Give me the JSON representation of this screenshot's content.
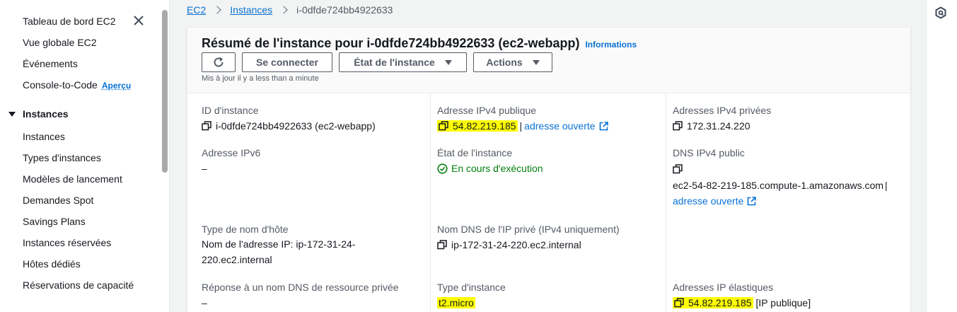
{
  "sidebar": {
    "items_top": [
      "Tableau de bord EC2",
      "Vue globale EC2",
      "Événements",
      "Console-to-Code"
    ],
    "console_badge": "Aperçu",
    "section": "Instances",
    "instances_items": [
      "Instances",
      "Types d'instances",
      "Modèles de lancement",
      "Demandes Spot",
      "Savings Plans",
      "Instances réservées",
      "Hôtes dédiés",
      "Réservations de capacité"
    ]
  },
  "breadcrumb": {
    "root": "EC2",
    "parent": "Instances",
    "current": "i-0dfde724bb4922633"
  },
  "panel": {
    "title": "Résumé de l'instance pour i-0dfde724bb4922633 (ec2-webapp)",
    "info_link": "Informations",
    "connect_button": "Se connecter",
    "state_button": "État de l'instance",
    "actions_button": "Actions",
    "updated": "Mis à jour il y a less than a minute"
  },
  "details": {
    "instance_id_label": "ID d'instance",
    "instance_id_value": "i-0dfde724bb4922633 (ec2-webapp)",
    "public_ipv4_label": "Adresse IPv4 publique",
    "public_ipv4_value": "54.82.219.185",
    "open_address": "adresse ouverte",
    "private_ipv4_label": "Adresses IPv4 privées",
    "private_ipv4_value": "172.31.24.220",
    "ipv6_label": "Adresse IPv6",
    "ipv6_value": "–",
    "state_label": "État de l'instance",
    "state_value": "En cours d'exécution",
    "public_dns_label": "DNS IPv4 public",
    "public_dns_value": "ec2-54-82-219-185.compute-1.amazonaws.com",
    "hostname_type_label": "Type de nom d'hôte",
    "hostname_type_value": "Nom de l'adresse IP: ip-172-31-24-220.ec2.internal",
    "private_dns_label": "Nom DNS de l'IP privé (IPv4 uniquement)",
    "private_dns_value": "ip-172-31-24-220.ec2.internal",
    "resource_dns_label": "Réponse à un nom DNS de ressource privée",
    "resource_dns_value": "–",
    "instance_type_label": "Type d'instance",
    "instance_type_value": "t2.micro",
    "elastic_ip_label": "Adresses IP élastiques",
    "elastic_ip_value": "54.82.219.185",
    "elastic_ip_suffix": "[IP publique]"
  },
  "colors": {
    "link": "#0972d3",
    "success": "#037f0c",
    "highlight": "#ffff00"
  }
}
